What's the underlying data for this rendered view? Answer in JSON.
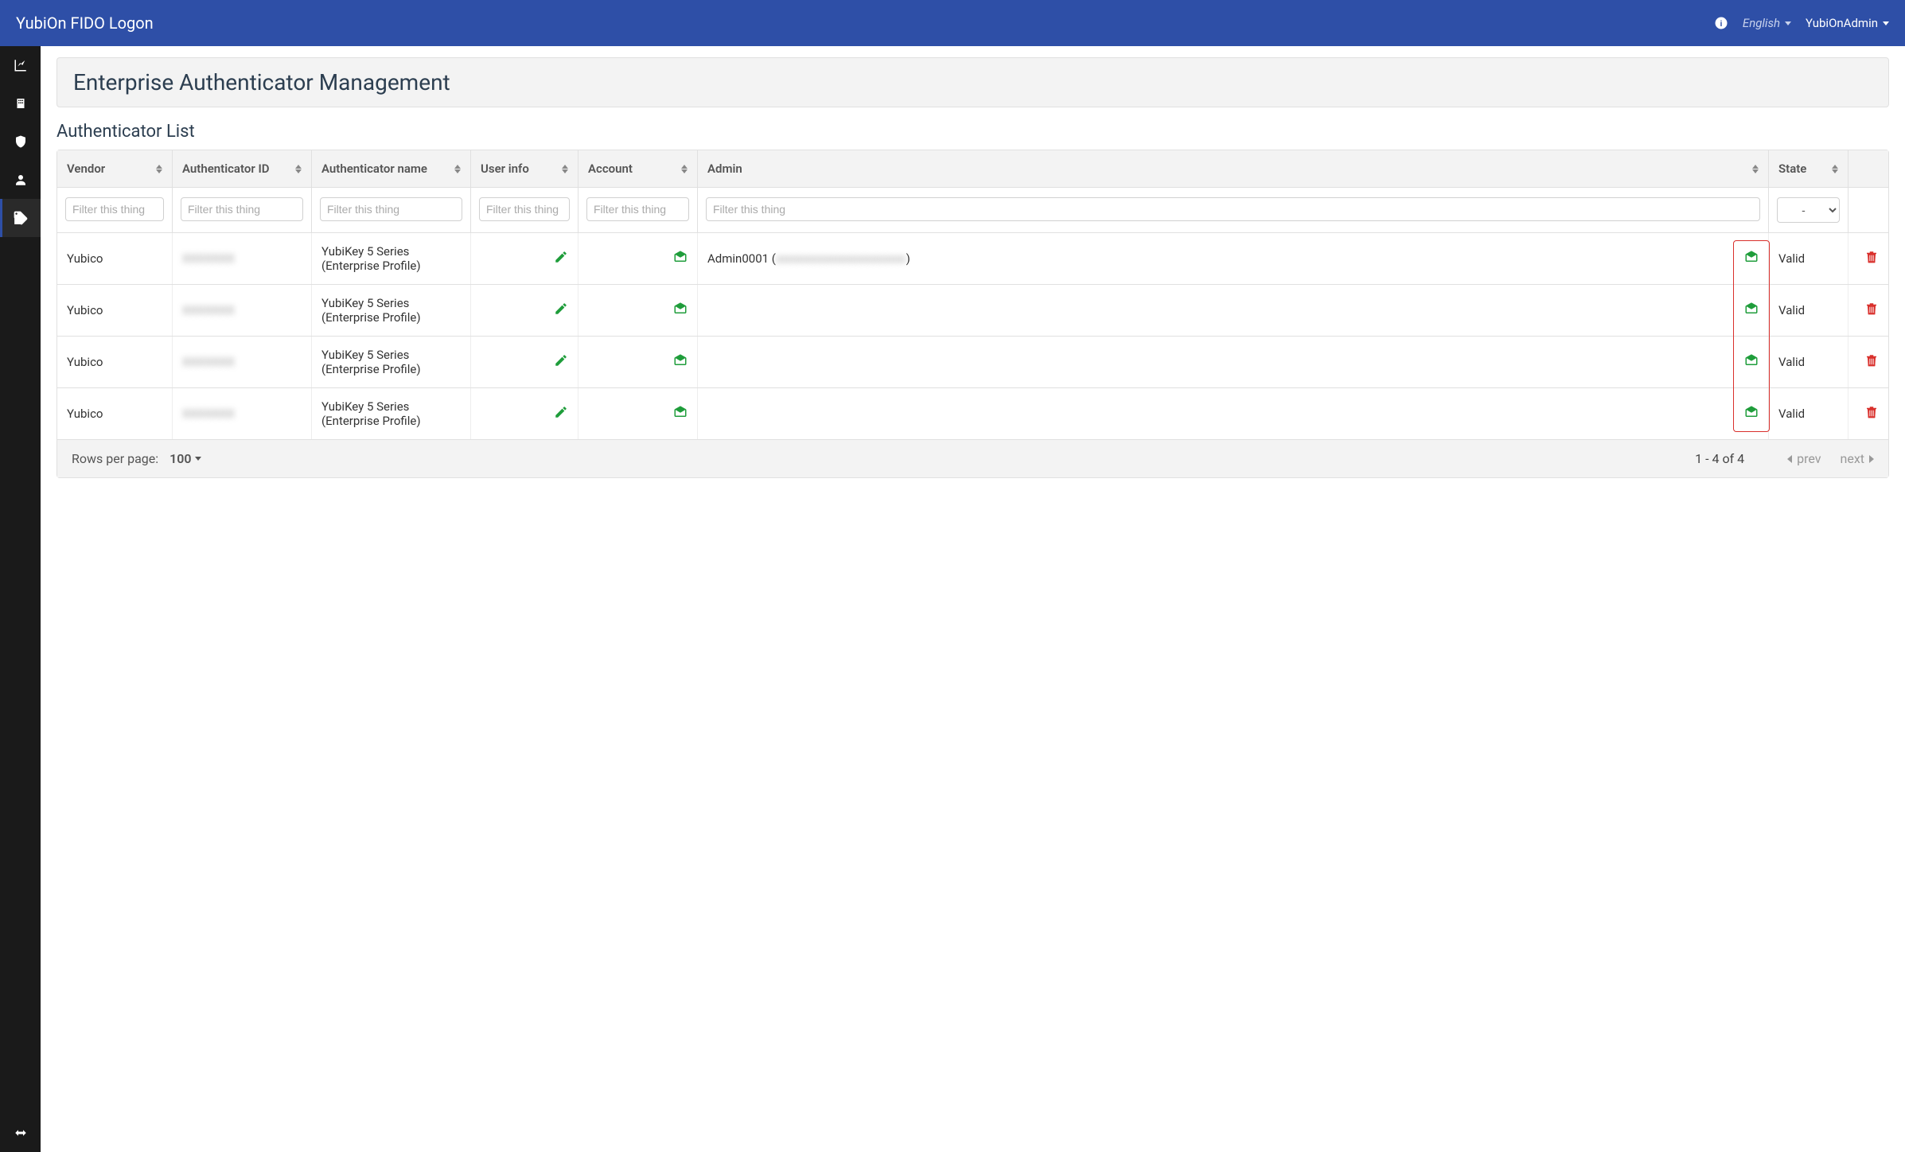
{
  "header": {
    "brand": "YubiOn FIDO Logon",
    "language": "English",
    "user": "YubiOnAdmin"
  },
  "page": {
    "title": "Enterprise Authenticator Management",
    "list_title": "Authenticator List"
  },
  "table": {
    "columns": {
      "vendor": "Vendor",
      "authid": "Authenticator ID",
      "authname": "Authenticator name",
      "userinfo": "User info",
      "account": "Account",
      "admin": "Admin",
      "state": "State"
    },
    "filter_placeholder": "Filter this thing",
    "state_filter_placeholder": "-",
    "rows": [
      {
        "vendor": "Yubico",
        "authid": "",
        "authname": "YubiKey 5 Series (Enterprise Profile)",
        "admin": "Admin0001 (",
        "admin_suffix": ")",
        "state": "Valid"
      },
      {
        "vendor": "Yubico",
        "authid": "",
        "authname": "YubiKey 5 Series (Enterprise Profile)",
        "admin": "",
        "admin_suffix": "",
        "state": "Valid"
      },
      {
        "vendor": "Yubico",
        "authid": "",
        "authname": "YubiKey 5 Series (Enterprise Profile)",
        "admin": "",
        "admin_suffix": "",
        "state": "Valid"
      },
      {
        "vendor": "Yubico",
        "authid": "",
        "authname": "YubiKey 5 Series (Enterprise Profile)",
        "admin": "",
        "admin_suffix": "",
        "state": "Valid"
      }
    ]
  },
  "footer": {
    "rows_per_page_label": "Rows per page:",
    "rows_per_page_value": "100",
    "range": "1 - 4 of 4",
    "prev": "prev",
    "next": "next"
  }
}
